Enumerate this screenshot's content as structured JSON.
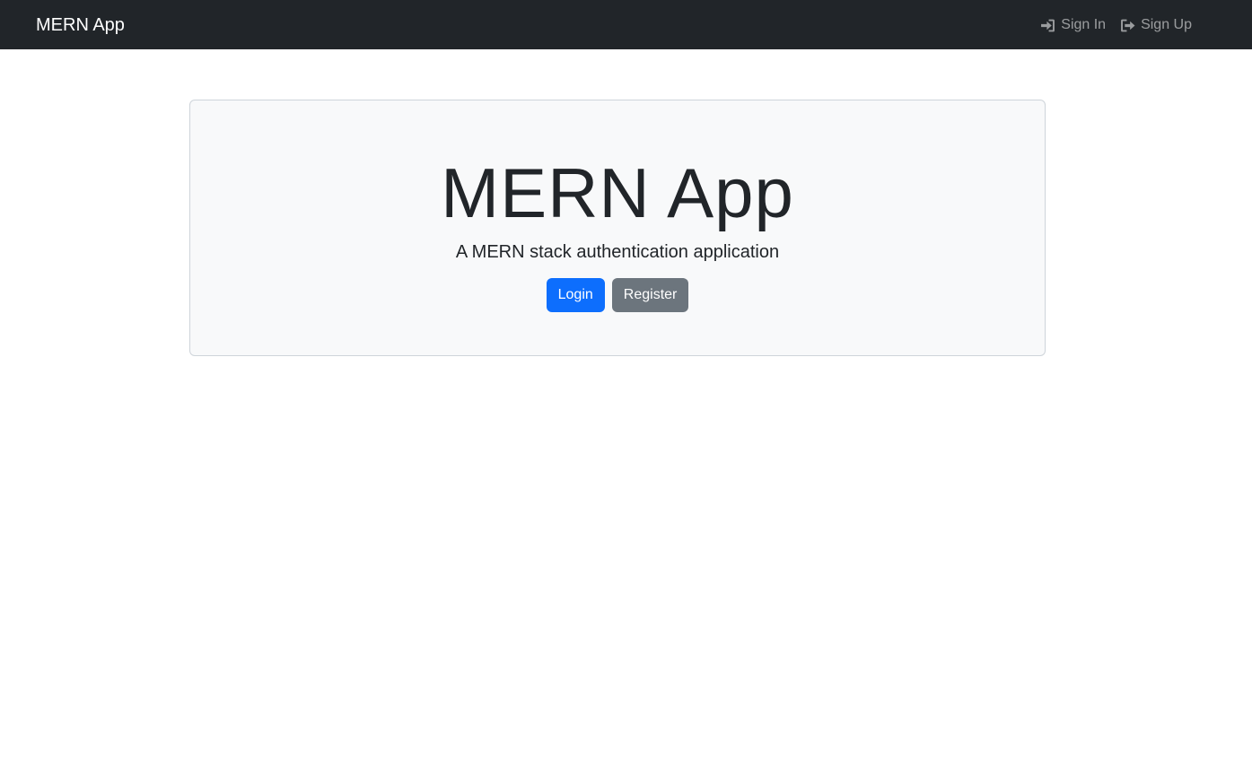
{
  "navbar": {
    "brand": "MERN App",
    "links": [
      {
        "label": "Sign In",
        "icon": "sign-in-icon"
      },
      {
        "label": "Sign Up",
        "icon": "sign-out-icon"
      }
    ]
  },
  "hero": {
    "title": "MERN App",
    "subtitle": "A MERN stack authentication application",
    "buttons": {
      "login": "Login",
      "register": "Register"
    }
  },
  "colors": {
    "navbar_bg": "#212529",
    "hero_bg": "#f8f9fa",
    "primary": "#0d6efd",
    "secondary": "#6c757d"
  }
}
